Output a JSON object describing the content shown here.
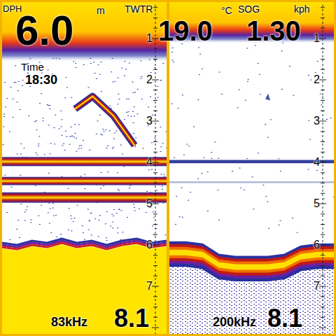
{
  "readouts": [
    {
      "label": "DPH",
      "unit": "m",
      "value": "6.0"
    },
    {
      "label": "TWTR",
      "unit": "°C",
      "value": "19.0"
    },
    {
      "label": "SOG",
      "unit": "kph",
      "value": "1.30"
    }
  ],
  "time": {
    "label": "Time",
    "value": "18:30"
  },
  "panes": [
    {
      "frequency": "83kHz",
      "range": "8.1",
      "scale": [
        "1",
        "2",
        "3",
        "4",
        "5",
        "6",
        "7"
      ],
      "surface_depth": 1.45,
      "noise": 0.6,
      "bottom": [
        6.05,
        6.1,
        6.0,
        6.05,
        5.95,
        6.05,
        6.0,
        6.1,
        6.0,
        5.95,
        6.05,
        6.0
      ],
      "bottom_style": "solid",
      "layers": [
        {
          "depth": 3.98,
          "thickness": 0.22,
          "strength": 1
        },
        {
          "depth": 4.45,
          "thickness": 0.2,
          "strength": 1
        },
        {
          "depth": 4.85,
          "thickness": 0.25,
          "strength": 1
        }
      ],
      "targets": [
        {
          "position": 0.55,
          "depth": 2.4,
          "strength": 1
        }
      ]
    },
    {
      "frequency": "200kHz",
      "range": "8.1",
      "scale": [
        "1",
        "2",
        "3",
        "4",
        "5",
        "6",
        "7"
      ],
      "surface_depth": 1.0,
      "noise": 0.15,
      "bottom": [
        5.95,
        5.95,
        6.0,
        6.25,
        6.3,
        6.3,
        6.3,
        6.25,
        6.05,
        6.0,
        6.0
      ],
      "bottom_style": "soft",
      "layers": [
        {
          "depth": 3.98,
          "thickness": 0.08,
          "strength": 0.9
        },
        {
          "depth": 4.48,
          "thickness": 0.04,
          "strength": 0.35
        }
      ],
      "targets": [
        {
          "position": 0.6,
          "depth": 2.4,
          "strength": 0.4
        }
      ]
    }
  ]
}
